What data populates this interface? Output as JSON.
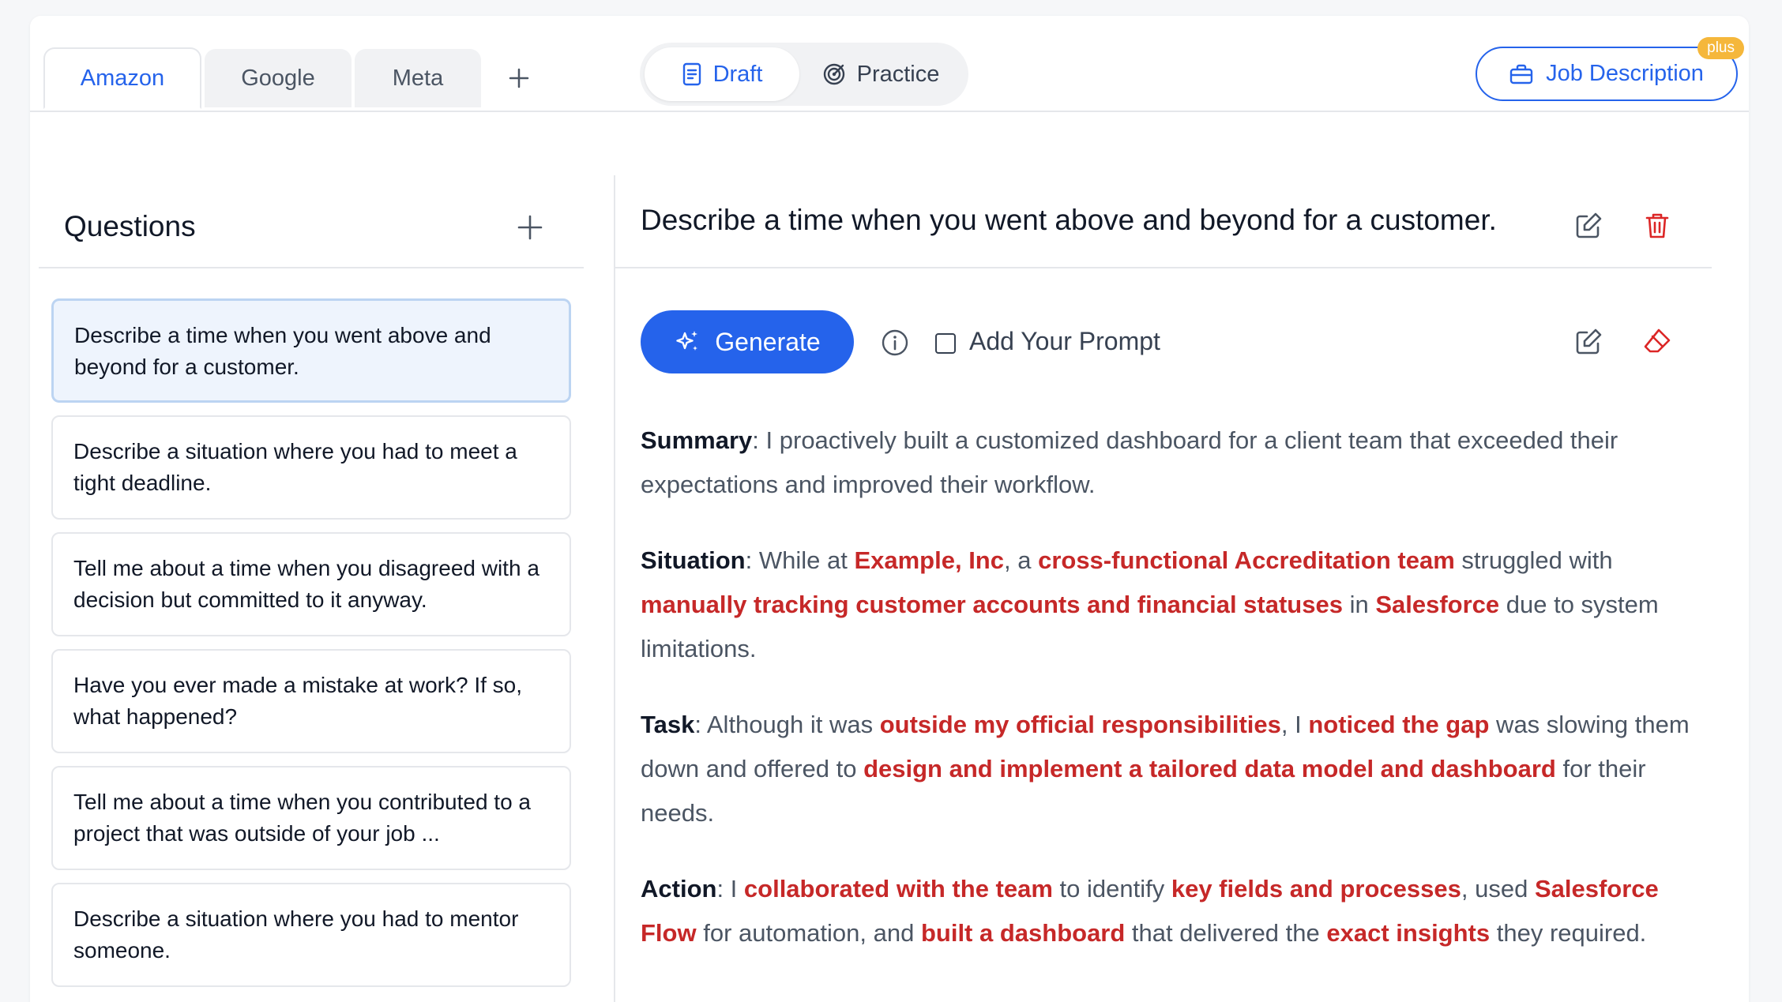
{
  "company_tabs": [
    {
      "label": "Amazon",
      "active": true
    },
    {
      "label": "Google",
      "active": false
    },
    {
      "label": "Meta",
      "active": false
    }
  ],
  "mode_toggle": {
    "draft_label": "Draft",
    "practice_label": "Practice",
    "active": "Draft"
  },
  "job_description": {
    "label": "Job Description",
    "badge": "plus"
  },
  "questions_panel": {
    "title": "Questions",
    "items": [
      {
        "text": "Describe a time when you went above and beyond for a customer.",
        "selected": true
      },
      {
        "text": "Describe a situation where you had to meet a tight deadline.",
        "selected": false
      },
      {
        "text": "Tell me about a time when you disagreed with a decision but committed to it anyway.",
        "selected": false
      },
      {
        "text": "Have you ever made a mistake at work? If so, what happened?",
        "selected": false
      },
      {
        "text": "Tell me about a time when you contributed to a project that was outside of your job ...",
        "selected": false
      },
      {
        "text": "Describe a situation where you had to mentor someone.",
        "selected": false
      }
    ]
  },
  "detail": {
    "question": "Describe a time when you went above and beyond for a customer.",
    "generate_label": "Generate",
    "add_prompt_label": "Add Your Prompt",
    "add_prompt_checked": false,
    "answer": {
      "summary": {
        "label": "Summary",
        "text": "I proactively built a customized dashboard for a client team that exceeded their expectations and improved their workflow."
      },
      "situation": {
        "label": "Situation",
        "t1": "While at ",
        "h1": "Example, Inc",
        "t2": ", a ",
        "h2": "cross-functional Accreditation team",
        "t3": " struggled with ",
        "h3": "manually tracking customer accounts and financial statuses",
        "t4": " in ",
        "h4": "Salesforce",
        "t5": " due to system limitations."
      },
      "task": {
        "label": "Task",
        "t1": "Although it was ",
        "h1": "outside my official responsibilities",
        "t2": ", I ",
        "h2": "noticed the gap",
        "t3": " was slowing them down and offered to ",
        "h3": "design and implement a tailored data model and dashboard",
        "t4": " for their needs."
      },
      "action": {
        "label": "Action",
        "t1": "I ",
        "h1": "collaborated with the team",
        "t2": " to identify ",
        "h2": "key fields and processes",
        "t3": ", used ",
        "h3": "Salesforce Flow",
        "t4": " for automation, and ",
        "h4": "built a dashboard",
        "t5": " that delivered the ",
        "h5": "exact insights",
        "t6": " they required."
      }
    }
  },
  "colors": {
    "accent": "#2563eb",
    "highlight": "#c62828",
    "selected_bg": "#eef4fd",
    "danger": "#dc2626",
    "badge": "#f5b73b"
  }
}
